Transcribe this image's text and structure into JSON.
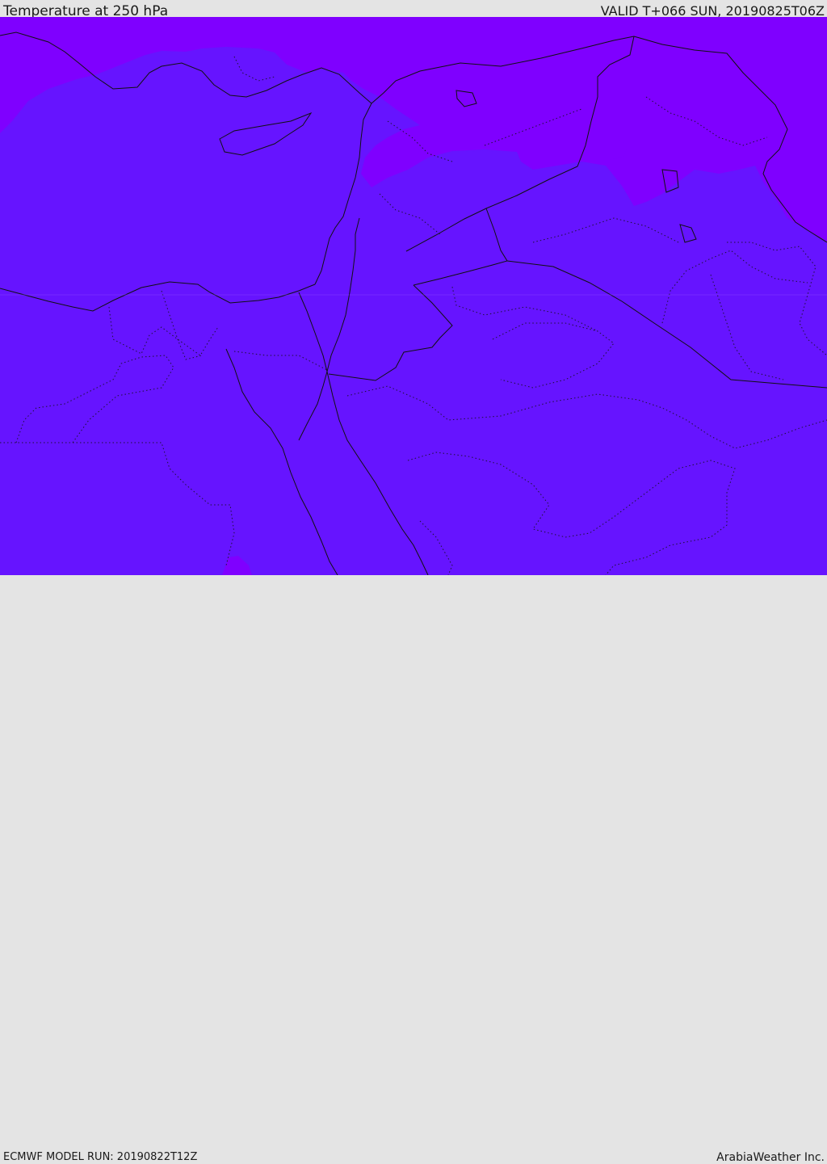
{
  "header": {
    "title": "Temperature at 250 hPa",
    "valid": "VALID T+066 SUN, 20190825T06Z"
  },
  "footer": {
    "model_run": "ECMWF MODEL RUN: 20190822T12Z",
    "credit": "ArabiaWeather Inc."
  },
  "map": {
    "colors": {
      "cold_field": "#6614ff",
      "colder_field": "#7f00ff",
      "border": "#111111"
    }
  }
}
